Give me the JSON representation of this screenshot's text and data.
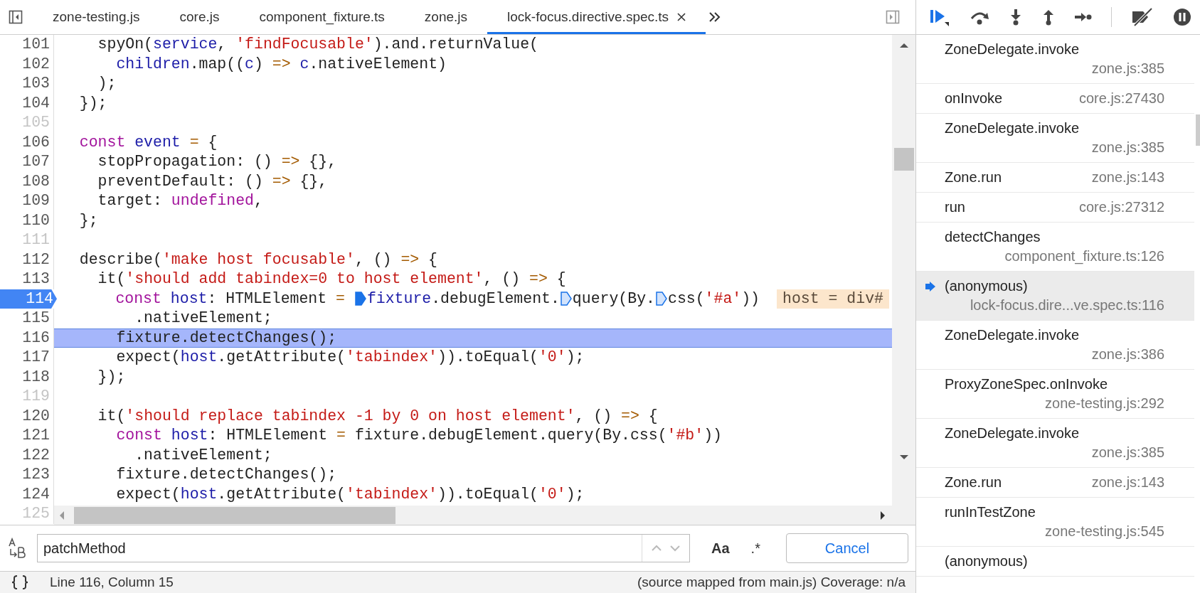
{
  "tabs": [
    {
      "label": "zone-testing.js",
      "selected": false
    },
    {
      "label": "core.js",
      "selected": false
    },
    {
      "label": "component_fixture.ts",
      "selected": false
    },
    {
      "label": "zone.js",
      "selected": false
    },
    {
      "label": "lock-focus.directive.spec.ts",
      "selected": true
    }
  ],
  "code": {
    "lines": [
      {
        "number": "101",
        "breakpoint": false,
        "current": false,
        "tokens": [
          {
            "t": "    spyOn(",
            "kind": "plain"
          },
          {
            "t": "service",
            "kind": "var"
          },
          {
            "t": ", ",
            "kind": "plain"
          },
          {
            "t": "'findFocusable'",
            "kind": "str"
          },
          {
            "t": ").and.returnValue(",
            "kind": "plain"
          }
        ]
      },
      {
        "number": "102",
        "breakpoint": false,
        "current": false,
        "tokens": [
          {
            "t": "      children",
            "kind": "var"
          },
          {
            "t": ".map((",
            "kind": "plain"
          },
          {
            "t": "c",
            "kind": "var"
          },
          {
            "t": ") ",
            "kind": "plain"
          },
          {
            "t": "=> ",
            "kind": "op"
          },
          {
            "t": "c",
            "kind": "var"
          },
          {
            "t": ".nativeElement)",
            "kind": "plain"
          }
        ]
      },
      {
        "number": "103",
        "breakpoint": false,
        "current": false,
        "tokens": [
          {
            "t": "    );",
            "kind": "plain"
          }
        ]
      },
      {
        "number": "104",
        "breakpoint": false,
        "current": false,
        "tokens": [
          {
            "t": "  });",
            "kind": "plain"
          }
        ]
      },
      {
        "number": "105",
        "breakpoint": false,
        "current": false
      },
      {
        "number": "106",
        "breakpoint": false,
        "current": false,
        "tokens": [
          {
            "t": "  const ",
            "kind": "kw"
          },
          {
            "t": "event ",
            "kind": "var"
          },
          {
            "t": "=",
            "kind": "op"
          },
          {
            "t": " {",
            "kind": "plain"
          }
        ]
      },
      {
        "number": "107",
        "breakpoint": false,
        "current": false,
        "tokens": [
          {
            "t": "    stopPropagation: () ",
            "kind": "plain"
          },
          {
            "t": "=>",
            "kind": "op"
          },
          {
            "t": " {},",
            "kind": "plain"
          }
        ]
      },
      {
        "number": "108",
        "breakpoint": false,
        "current": false,
        "tokens": [
          {
            "t": "    preventDefault: () ",
            "kind": "plain"
          },
          {
            "t": "=>",
            "kind": "op"
          },
          {
            "t": " {},",
            "kind": "plain"
          }
        ]
      },
      {
        "number": "109",
        "breakpoint": false,
        "current": false,
        "tokens": [
          {
            "t": "    target: ",
            "kind": "plain"
          },
          {
            "t": "undefined",
            "kind": "kw"
          },
          {
            "t": ",",
            "kind": "plain"
          }
        ]
      },
      {
        "number": "110",
        "breakpoint": false,
        "current": false,
        "tokens": [
          {
            "t": "  };",
            "kind": "plain"
          }
        ]
      },
      {
        "number": "111",
        "breakpoint": false,
        "current": false
      },
      {
        "number": "112",
        "breakpoint": false,
        "current": false,
        "tokens": [
          {
            "t": "  describe(",
            "kind": "plain"
          },
          {
            "t": "'make host focusable'",
            "kind": "str"
          },
          {
            "t": ", () ",
            "kind": "plain"
          },
          {
            "t": "=>",
            "kind": "op"
          },
          {
            "t": " {",
            "kind": "plain"
          }
        ]
      },
      {
        "number": "113",
        "breakpoint": false,
        "current": false,
        "tokens": [
          {
            "t": "    it(",
            "kind": "plain"
          },
          {
            "t": "'should add tabindex=0 to host element'",
            "kind": "str"
          },
          {
            "t": ", () ",
            "kind": "plain"
          },
          {
            "t": "=>",
            "kind": "op"
          },
          {
            "t": " {",
            "kind": "plain"
          }
        ]
      },
      {
        "number": "114",
        "breakpoint": true,
        "current": false,
        "inline_value": "host = div#",
        "tokens": [
          {
            "t": "      const ",
            "kind": "kw"
          },
          {
            "t": "host",
            "kind": "var"
          },
          {
            "t": ": HTMLElement ",
            "kind": "plain"
          },
          {
            "t": "= ",
            "kind": "op"
          },
          {
            "kind": "stop",
            "active": true
          },
          {
            "t": "fixture",
            "kind": "var"
          },
          {
            "t": ".debugElement.",
            "kind": "plain"
          },
          {
            "kind": "stop",
            "active": false
          },
          {
            "t": "query(By.",
            "kind": "plain"
          },
          {
            "kind": "stop",
            "active": false
          },
          {
            "t": "css(",
            "kind": "plain"
          },
          {
            "t": "'#a'",
            "kind": "str"
          },
          {
            "t": "))",
            "kind": "plain"
          }
        ]
      },
      {
        "number": "115",
        "breakpoint": false,
        "current": false,
        "tokens": [
          {
            "t": "        .nativeElement;",
            "kind": "plain"
          }
        ]
      },
      {
        "number": "116",
        "breakpoint": false,
        "current": true,
        "tokens": [
          {
            "t": "      fixture.detectChanges();",
            "kind": "plain"
          }
        ]
      },
      {
        "number": "117",
        "breakpoint": false,
        "current": false,
        "tokens": [
          {
            "t": "      expect(",
            "kind": "plain"
          },
          {
            "t": "host",
            "kind": "var"
          },
          {
            "t": ".getAttribute(",
            "kind": "plain"
          },
          {
            "t": "'tabindex'",
            "kind": "str"
          },
          {
            "t": ")).toEqual(",
            "kind": "plain"
          },
          {
            "t": "'0'",
            "kind": "str"
          },
          {
            "t": ");",
            "kind": "plain"
          }
        ]
      },
      {
        "number": "118",
        "breakpoint": false,
        "current": false,
        "tokens": [
          {
            "t": "    });",
            "kind": "plain"
          }
        ]
      },
      {
        "number": "119",
        "breakpoint": false,
        "current": false
      },
      {
        "number": "120",
        "breakpoint": false,
        "current": false,
        "tokens": [
          {
            "t": "    it(",
            "kind": "plain"
          },
          {
            "t": "'should replace tabindex -1 by 0 on host element'",
            "kind": "str"
          },
          {
            "t": ", () ",
            "kind": "plain"
          },
          {
            "t": "=>",
            "kind": "op"
          },
          {
            "t": " {",
            "kind": "plain"
          }
        ]
      },
      {
        "number": "121",
        "breakpoint": false,
        "current": false,
        "tokens": [
          {
            "t": "      const ",
            "kind": "kw"
          },
          {
            "t": "host",
            "kind": "var"
          },
          {
            "t": ": HTMLElement ",
            "kind": "plain"
          },
          {
            "t": "=",
            "kind": "op"
          },
          {
            "t": " fixture.debugElement.query(By.css(",
            "kind": "plain"
          },
          {
            "t": "'#b'",
            "kind": "str"
          },
          {
            "t": "))",
            "kind": "plain"
          }
        ]
      },
      {
        "number": "122",
        "breakpoint": false,
        "current": false,
        "tokens": [
          {
            "t": "        .nativeElement;",
            "kind": "plain"
          }
        ]
      },
      {
        "number": "123",
        "breakpoint": false,
        "current": false,
        "tokens": [
          {
            "t": "      fixture.detectChanges();",
            "kind": "plain"
          }
        ]
      },
      {
        "number": "124",
        "breakpoint": false,
        "current": false,
        "tokens": [
          {
            "t": "      expect(",
            "kind": "plain"
          },
          {
            "t": "host",
            "kind": "var"
          },
          {
            "t": ".getAttribute(",
            "kind": "plain"
          },
          {
            "t": "'tabindex'",
            "kind": "str"
          },
          {
            "t": ")).toEqual(",
            "kind": "plain"
          },
          {
            "t": "'0'",
            "kind": "str"
          },
          {
            "t": ");",
            "kind": "plain"
          }
        ]
      },
      {
        "number": "125",
        "breakpoint": false,
        "current": false
      }
    ]
  },
  "find_bar": {
    "value": "patchMethod",
    "match_case": "Aa",
    "regex": ".*",
    "cancel": "Cancel"
  },
  "status_bar": {
    "position": "Line 116, Column 15",
    "source": "(source mapped from main.js) Coverage: n/a"
  },
  "call_stack": [
    {
      "name": "ZoneDelegate.invoke",
      "location": "zone.js:385",
      "selected": false
    },
    {
      "name": "onInvoke",
      "location": "core.js:27430",
      "selected": false
    },
    {
      "name": "ZoneDelegate.invoke",
      "location": "zone.js:385",
      "selected": false
    },
    {
      "name": "Zone.run",
      "location": "zone.js:143",
      "selected": false
    },
    {
      "name": "run",
      "location": "core.js:27312",
      "selected": false
    },
    {
      "name": "detectChanges",
      "location": "component_fixture.ts:126",
      "selected": false
    },
    {
      "name": "(anonymous)",
      "location": "lock-focus.dire...ve.spec.ts:116",
      "selected": true
    },
    {
      "name": "ZoneDelegate.invoke",
      "location": "zone.js:386",
      "selected": false
    },
    {
      "name": "ProxyZoneSpec.onInvoke",
      "location": "zone-testing.js:292",
      "selected": false
    },
    {
      "name": "ZoneDelegate.invoke",
      "location": "zone.js:385",
      "selected": false
    },
    {
      "name": "Zone.run",
      "location": "zone.js:143",
      "selected": false
    },
    {
      "name": "runInTestZone",
      "location": "zone-testing.js:545",
      "selected": false
    },
    {
      "name": "(anonymous)",
      "selected": false
    }
  ]
}
